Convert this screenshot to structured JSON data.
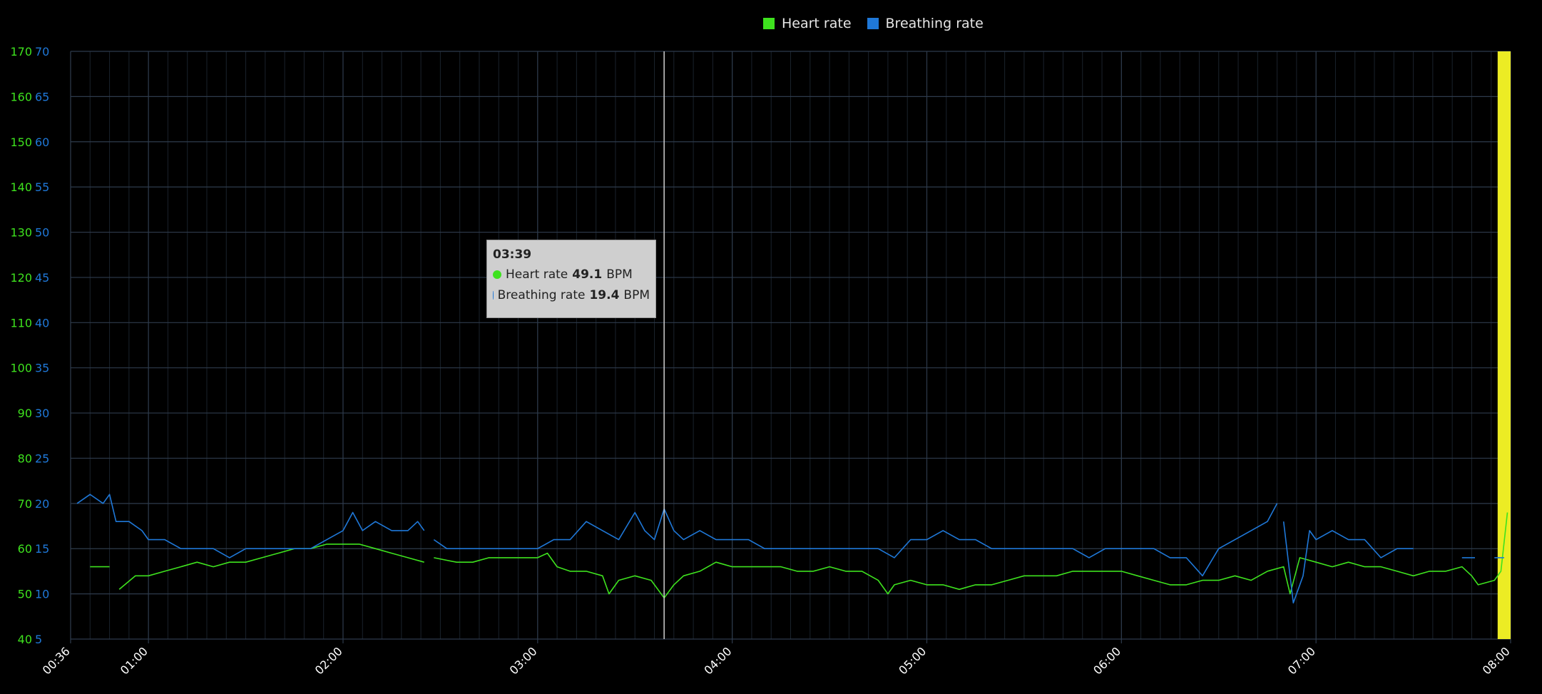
{
  "colors": {
    "heart": "#3ee21e",
    "breath": "#1f78d8",
    "grid_major": "#2e3b4c",
    "grid_minor": "#1a222c",
    "highlight": "#ecec24",
    "cursor": "#cfcfcf",
    "background": "#000000"
  },
  "legend": [
    {
      "label": "Heart rate",
      "color": "#3ee21e"
    },
    {
      "label": "Breathing rate",
      "color": "#1f78d8"
    }
  ],
  "tooltip": {
    "time": "03:39",
    "heart_label": "Heart rate",
    "heart_value": "49.1",
    "breath_label": "Breathing rate",
    "breath_value": "19.4",
    "unit": "BPM"
  },
  "chart_data": {
    "type": "line",
    "x_range": [
      "00:36",
      "08:00"
    ],
    "x_ticks": [
      "00:36",
      "01:00",
      "02:00",
      "03:00",
      "04:00",
      "05:00",
      "06:00",
      "07:00",
      "08:00"
    ],
    "y_left": {
      "range": [
        40,
        170
      ],
      "ticks": [
        40,
        50,
        60,
        70,
        80,
        90,
        100,
        110,
        120,
        130,
        140,
        150,
        160,
        170
      ],
      "color": "#3ee21e"
    },
    "y_right": {
      "range": [
        5,
        70
      ],
      "ticks": [
        5,
        10,
        15,
        20,
        25,
        30,
        35,
        40,
        45,
        50,
        55,
        60,
        65,
        70
      ],
      "color": "#1f78d8"
    },
    "grid": true,
    "legend_position": "top-center",
    "cursor_time": "03:39",
    "highlight_range": [
      "07:56",
      "08:00"
    ],
    "series": [
      {
        "name": "Heart rate",
        "axis": "left",
        "color": "#3ee21e",
        "points": [
          [
            "00:42",
            56
          ],
          [
            "00:48",
            56
          ],
          [
            "00:49",
            null
          ],
          [
            "00:51",
            51
          ],
          [
            "00:56",
            54
          ],
          [
            "01:00",
            54
          ],
          [
            "01:05",
            55
          ],
          [
            "01:10",
            56
          ],
          [
            "01:15",
            57
          ],
          [
            "01:20",
            56
          ],
          [
            "01:25",
            57
          ],
          [
            "01:30",
            57
          ],
          [
            "01:35",
            58
          ],
          [
            "01:40",
            59
          ],
          [
            "01:45",
            60
          ],
          [
            "01:50",
            60
          ],
          [
            "01:55",
            61
          ],
          [
            "02:00",
            61
          ],
          [
            "02:05",
            61
          ],
          [
            "02:10",
            60
          ],
          [
            "02:15",
            59
          ],
          [
            "02:20",
            58
          ],
          [
            "02:25",
            57
          ],
          [
            "02:26",
            null
          ],
          [
            "02:28",
            58
          ],
          [
            "02:35",
            57
          ],
          [
            "02:40",
            57
          ],
          [
            "02:45",
            58
          ],
          [
            "02:50",
            58
          ],
          [
            "02:55",
            58
          ],
          [
            "03:00",
            58
          ],
          [
            "03:03",
            59
          ],
          [
            "03:06",
            56
          ],
          [
            "03:10",
            55
          ],
          [
            "03:15",
            55
          ],
          [
            "03:20",
            54
          ],
          [
            "03:22",
            50
          ],
          [
            "03:25",
            53
          ],
          [
            "03:30",
            54
          ],
          [
            "03:35",
            53
          ],
          [
            "03:39",
            49.1
          ],
          [
            "03:42",
            52
          ],
          [
            "03:45",
            54
          ],
          [
            "03:50",
            55
          ],
          [
            "03:55",
            57
          ],
          [
            "04:00",
            56
          ],
          [
            "04:05",
            56
          ],
          [
            "04:10",
            56
          ],
          [
            "04:15",
            56
          ],
          [
            "04:20",
            55
          ],
          [
            "04:25",
            55
          ],
          [
            "04:30",
            56
          ],
          [
            "04:35",
            55
          ],
          [
            "04:40",
            55
          ],
          [
            "04:45",
            53
          ],
          [
            "04:48",
            50
          ],
          [
            "04:50",
            52
          ],
          [
            "04:55",
            53
          ],
          [
            "05:00",
            52
          ],
          [
            "05:05",
            52
          ],
          [
            "05:10",
            51
          ],
          [
            "05:15",
            52
          ],
          [
            "05:20",
            52
          ],
          [
            "05:25",
            53
          ],
          [
            "05:30",
            54
          ],
          [
            "05:35",
            54
          ],
          [
            "05:40",
            54
          ],
          [
            "05:45",
            55
          ],
          [
            "05:50",
            55
          ],
          [
            "05:55",
            55
          ],
          [
            "06:00",
            55
          ],
          [
            "06:05",
            54
          ],
          [
            "06:10",
            53
          ],
          [
            "06:15",
            52
          ],
          [
            "06:20",
            52
          ],
          [
            "06:25",
            53
          ],
          [
            "06:30",
            53
          ],
          [
            "06:35",
            54
          ],
          [
            "06:40",
            53
          ],
          [
            "06:45",
            55
          ],
          [
            "06:50",
            56
          ],
          [
            "06:52",
            50
          ],
          [
            "06:55",
            58
          ],
          [
            "07:00",
            57
          ],
          [
            "07:05",
            56
          ],
          [
            "07:10",
            57
          ],
          [
            "07:15",
            56
          ],
          [
            "07:20",
            56
          ],
          [
            "07:25",
            55
          ],
          [
            "07:30",
            54
          ],
          [
            "07:35",
            55
          ],
          [
            "07:40",
            55
          ],
          [
            "07:45",
            56
          ],
          [
            "07:48",
            54
          ],
          [
            "07:50",
            52
          ],
          [
            "07:55",
            53
          ],
          [
            "07:57",
            55
          ],
          [
            "07:59",
            68
          ]
        ]
      },
      {
        "name": "Breathing rate",
        "axis": "right",
        "color": "#1f78d8",
        "points": [
          [
            "00:38",
            20
          ],
          [
            "00:42",
            21
          ],
          [
            "00:46",
            20
          ],
          [
            "00:48",
            21
          ],
          [
            "00:50",
            18
          ],
          [
            "00:54",
            18
          ],
          [
            "00:58",
            17
          ],
          [
            "01:00",
            16
          ],
          [
            "01:05",
            16
          ],
          [
            "01:10",
            15
          ],
          [
            "01:15",
            15
          ],
          [
            "01:20",
            15
          ],
          [
            "01:25",
            14
          ],
          [
            "01:30",
            15
          ],
          [
            "01:35",
            15
          ],
          [
            "01:40",
            15
          ],
          [
            "01:45",
            15
          ],
          [
            "01:50",
            15
          ],
          [
            "01:55",
            16
          ],
          [
            "02:00",
            17
          ],
          [
            "02:03",
            19
          ],
          [
            "02:06",
            17
          ],
          [
            "02:10",
            18
          ],
          [
            "02:15",
            17
          ],
          [
            "02:20",
            17
          ],
          [
            "02:23",
            18
          ],
          [
            "02:25",
            17
          ],
          [
            "02:26",
            null
          ],
          [
            "02:28",
            16
          ],
          [
            "02:32",
            15
          ],
          [
            "02:36",
            15
          ],
          [
            "02:40",
            15
          ],
          [
            "02:45",
            15
          ],
          [
            "02:50",
            15
          ],
          [
            "02:55",
            15
          ],
          [
            "03:00",
            15
          ],
          [
            "03:05",
            16
          ],
          [
            "03:10",
            16
          ],
          [
            "03:15",
            18
          ],
          [
            "03:20",
            17
          ],
          [
            "03:25",
            16
          ],
          [
            "03:30",
            19
          ],
          [
            "03:33",
            17
          ],
          [
            "03:36",
            16
          ],
          [
            "03:39",
            19.4
          ],
          [
            "03:42",
            17
          ],
          [
            "03:45",
            16
          ],
          [
            "03:50",
            17
          ],
          [
            "03:55",
            16
          ],
          [
            "04:00",
            16
          ],
          [
            "04:05",
            16
          ],
          [
            "04:10",
            15
          ],
          [
            "04:15",
            15
          ],
          [
            "04:20",
            15
          ],
          [
            "04:25",
            15
          ],
          [
            "04:30",
            15
          ],
          [
            "04:35",
            15
          ],
          [
            "04:40",
            15
          ],
          [
            "04:45",
            15
          ],
          [
            "04:50",
            14
          ],
          [
            "04:55",
            16
          ],
          [
            "05:00",
            16
          ],
          [
            "05:05",
            17
          ],
          [
            "05:10",
            16
          ],
          [
            "05:15",
            16
          ],
          [
            "05:20",
            15
          ],
          [
            "05:25",
            15
          ],
          [
            "05:30",
            15
          ],
          [
            "05:35",
            15
          ],
          [
            "05:40",
            15
          ],
          [
            "05:45",
            15
          ],
          [
            "05:50",
            14
          ],
          [
            "05:55",
            15
          ],
          [
            "06:00",
            15
          ],
          [
            "06:05",
            15
          ],
          [
            "06:10",
            15
          ],
          [
            "06:15",
            14
          ],
          [
            "06:20",
            14
          ],
          [
            "06:25",
            12
          ],
          [
            "06:30",
            15
          ],
          [
            "06:35",
            16
          ],
          [
            "06:40",
            17
          ],
          [
            "06:45",
            18
          ],
          [
            "06:48",
            20
          ],
          [
            "06:49",
            null
          ],
          [
            "06:50",
            18
          ],
          [
            "06:53",
            9
          ],
          [
            "06:56",
            12
          ],
          [
            "06:58",
            17
          ],
          [
            "07:00",
            16
          ],
          [
            "07:05",
            17
          ],
          [
            "07:10",
            16
          ],
          [
            "07:15",
            16
          ],
          [
            "07:20",
            14
          ],
          [
            "07:25",
            15
          ],
          [
            "07:30",
            15
          ],
          [
            "07:35",
            null
          ],
          [
            "07:45",
            14
          ],
          [
            "07:49",
            14
          ],
          [
            "07:50",
            null
          ],
          [
            "07:55",
            14
          ],
          [
            "07:58",
            14
          ]
        ]
      }
    ]
  }
}
